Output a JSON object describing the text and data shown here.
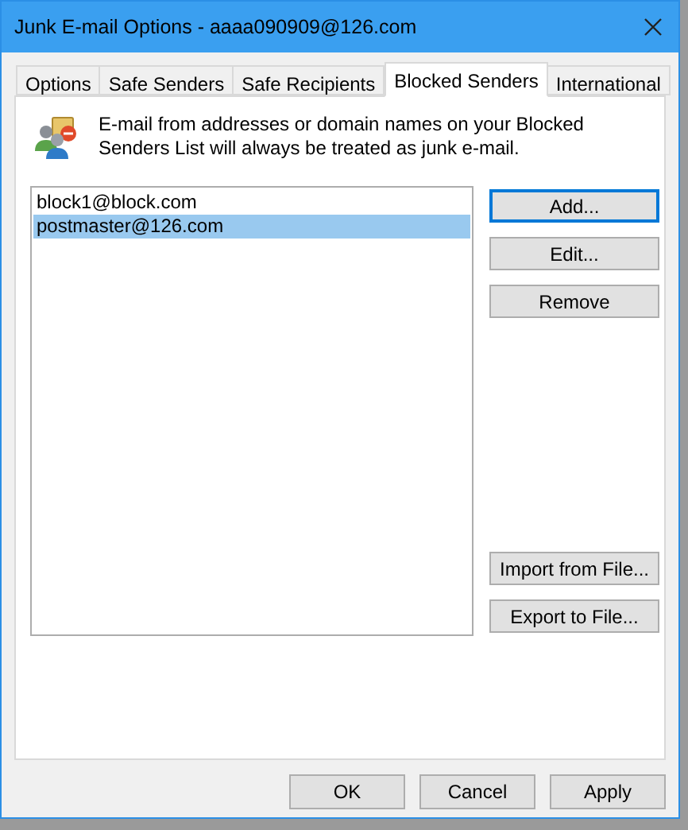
{
  "window": {
    "title": "Junk E-mail Options - aaaa090909@126.com"
  },
  "tabs": [
    {
      "label": "Options",
      "selected": false
    },
    {
      "label": "Safe Senders",
      "selected": false
    },
    {
      "label": "Safe Recipients",
      "selected": false
    },
    {
      "label": "Blocked Senders",
      "selected": true
    },
    {
      "label": "International",
      "selected": false
    }
  ],
  "description": "E-mail from addresses or domain names on your Blocked Senders List will always be treated as junk e-mail.",
  "senders": [
    {
      "address": "block1@block.com",
      "selected": false
    },
    {
      "address": "postmaster@126.com",
      "selected": true
    }
  ],
  "side_buttons": [
    {
      "label": "Add...",
      "focused": true
    },
    {
      "label": "Edit...",
      "focused": false
    },
    {
      "label": "Remove",
      "focused": false
    }
  ],
  "file_buttons": [
    "Import from File...",
    "Export to File..."
  ],
  "footer_buttons": [
    "OK",
    "Cancel",
    "Apply"
  ]
}
